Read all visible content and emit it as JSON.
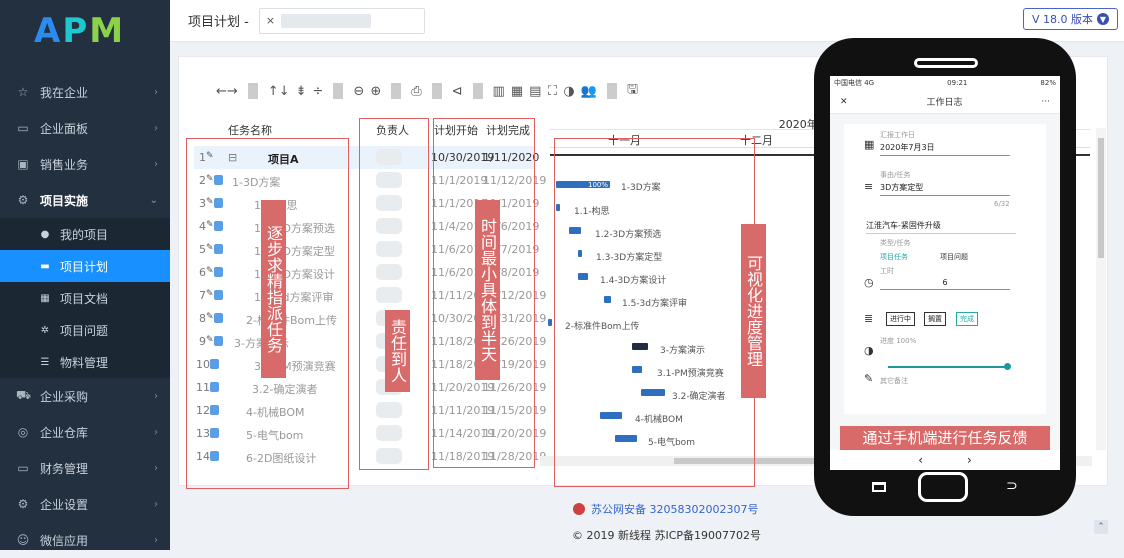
{
  "logo": {
    "a": "A",
    "p": "P",
    "m": "M"
  },
  "sidebar": {
    "items": [
      {
        "label": "我在企业",
        "icon": "star-icon"
      },
      {
        "label": "企业面板",
        "icon": "monitor-icon"
      },
      {
        "label": "销售业务",
        "icon": "briefcase-icon"
      },
      {
        "label": "项目实施",
        "icon": "gears-icon"
      }
    ],
    "sub": [
      {
        "label": "我的项目",
        "icon": "globe-icon"
      },
      {
        "label": "项目计划",
        "icon": "card-icon"
      },
      {
        "label": "项目文档",
        "icon": "grid-icon"
      },
      {
        "label": "项目问题",
        "icon": "bug-icon"
      },
      {
        "label": "物料管理",
        "icon": "list-icon"
      }
    ],
    "items2": [
      {
        "label": "企业采购",
        "icon": "cart-icon"
      },
      {
        "label": "企业仓库",
        "icon": "database-icon"
      },
      {
        "label": "财务管理",
        "icon": "monitor-icon"
      },
      {
        "label": "企业设置",
        "icon": "gear-icon"
      },
      {
        "label": "微信应用",
        "icon": "wechat-icon"
      }
    ]
  },
  "topbar": {
    "title": "项目计划 -",
    "tab_close": "×",
    "version": "V 18.0 版本"
  },
  "toolbar": {
    "items": [
      "←→",
      "↑↓",
      "⇟",
      "÷",
      "⊖",
      "⊕",
      "⎙",
      "⊲",
      "▥",
      "▦",
      "▤",
      "⛶",
      "◑",
      "👥",
      "🖫"
    ]
  },
  "grid": {
    "headers": {
      "name": "任务名称",
      "owner": "负责人",
      "start": "计划开始",
      "end": "计划完成"
    },
    "rows": [
      {
        "num": "1",
        "name": "项目A",
        "start": "10/30/2019",
        "end": "1/11/2020"
      },
      {
        "num": "2",
        "name": "1-3D方案",
        "start": "11/1/2019",
        "end": "11/12/2019"
      },
      {
        "num": "3",
        "name": "1.1-构思",
        "start": "11/1/2019",
        "end": "11/1/2019"
      },
      {
        "num": "4",
        "name": "1.2-3D方案预选",
        "start": "11/4/2019",
        "end": "11/6/2019"
      },
      {
        "num": "5",
        "name": "1.3-3D方案定型",
        "start": "11/6/2019",
        "end": "11/7/2019"
      },
      {
        "num": "6",
        "name": "1.4-3D方案设计",
        "start": "11/6/2019",
        "end": "11/8/2019"
      },
      {
        "num": "7",
        "name": "1.5-3d方案评审",
        "start": "11/11/2019",
        "end": "11/12/2019"
      },
      {
        "num": "8",
        "name": "2-标准件Bom上传",
        "start": "10/30/2019",
        "end": "10/31/2019"
      },
      {
        "num": "9",
        "name": "3-方案演示",
        "start": "11/18/2019",
        "end": "11/26/2019"
      },
      {
        "num": "10",
        "name": "3.1-PM预演竞赛",
        "start": "11/18/2019",
        "end": "11/19/2019"
      },
      {
        "num": "11",
        "name": "3.2-确定演者",
        "start": "11/20/2019",
        "end": "11/26/2019"
      },
      {
        "num": "12",
        "name": "4-机械BOM",
        "start": "11/11/2019",
        "end": "11/15/2019"
      },
      {
        "num": "13",
        "name": "5-电气bom",
        "start": "11/14/2019",
        "end": "11/20/2019"
      },
      {
        "num": "14",
        "name": "6-2D图纸设计",
        "start": "11/18/2019",
        "end": "11/28/2019"
      }
    ]
  },
  "gantt": {
    "quarter": "2020年 第1季度",
    "months": [
      "十一月",
      "十二月"
    ],
    "bars": [
      {
        "label": "1-3D方案",
        "progress": "100%"
      },
      {
        "label": "1.1-构思"
      },
      {
        "label": "1.2-3D方案预选"
      },
      {
        "label": "1.3-3D方案定型"
      },
      {
        "label": "1.4-3D方案设计"
      },
      {
        "label": "1.5-3d方案评审"
      },
      {
        "label": "2-标准件Bom上传"
      },
      {
        "label": "3-方案演示"
      },
      {
        "label": "3.1-PM预演竞赛"
      },
      {
        "label": "3.2-确定演者"
      },
      {
        "label": "4-机械BOM"
      },
      {
        "label": "5-电气bom"
      }
    ]
  },
  "annotations": {
    "assign": "逐步求精指派任务",
    "owner": "责任到人",
    "time": "时间最小具体到半天",
    "visual": "可视化进度管理",
    "mobile": "通过手机端进行任务反馈"
  },
  "phone": {
    "carrier": "中国电信 4G",
    "time": "09:21",
    "battery": "82%",
    "app_title": "工作日志",
    "date_label": "汇报工作日",
    "date_value": "2020年7月3日",
    "task_label": "事由/任务",
    "task_value": "3D方案定型",
    "counter": "6/32",
    "project_value": "江淮汽车-紧固件升级",
    "type_label": "类型/任务",
    "type_opt1": "项目任务",
    "type_opt2": "项目问题",
    "hours_label": "工时",
    "hours_value": "6",
    "status_opts": [
      "进行中",
      "搁置",
      "完成"
    ],
    "progress_label": "进度 100%",
    "other_label": "其它备注",
    "nav_prev": "‹",
    "nav_next": "›"
  },
  "footer": {
    "police": "苏公网安备 32058302002307号",
    "icp": "© 2019 新线程 苏ICP备19007702号"
  }
}
